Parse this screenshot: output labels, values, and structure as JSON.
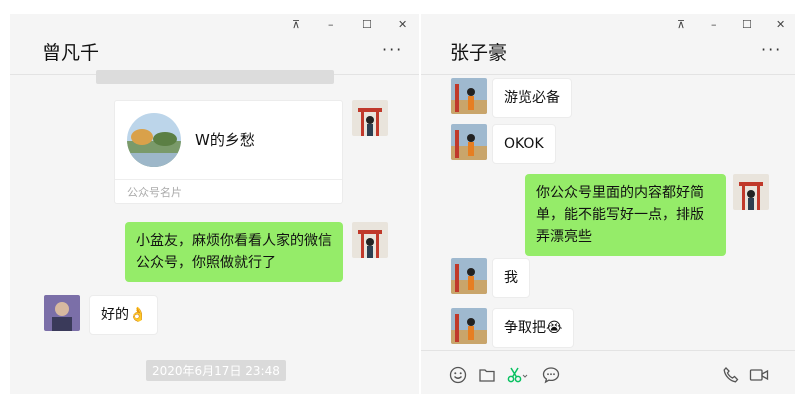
{
  "window_controls": {
    "pin": "⊼",
    "minimize": "–",
    "maximize": "☐",
    "close": "✕"
  },
  "left_chat": {
    "contact_name": "曾凡千",
    "more": "···",
    "card": {
      "title": "W的乡愁",
      "subtitle": "公众号名片"
    },
    "messages": [
      {
        "text": "小盆友，麻烦你看看人家的微信公众号，你照做就行了"
      },
      {
        "text": "好的👌"
      }
    ],
    "timestamp": "2020年6月17日 23:48"
  },
  "right_chat": {
    "contact_name": "张子豪",
    "more": "···",
    "messages": [
      {
        "text": "游览必备"
      },
      {
        "text": "OKOK"
      },
      {
        "text": "你公众号里面的内容都好简单，能不能写好一点，排版弄漂亮些"
      },
      {
        "text": "我"
      },
      {
        "text": "争取把😭"
      }
    ],
    "toolbar": [
      "emoji-icon",
      "folder-icon",
      "scissors-icon",
      "chat-history-icon",
      "phone-icon",
      "video-icon"
    ]
  },
  "colors": {
    "green_bubble": "#95ec69",
    "background": "#f5f5f5",
    "white_bubble": "#ffffff",
    "scissors_green": "#07c160"
  }
}
